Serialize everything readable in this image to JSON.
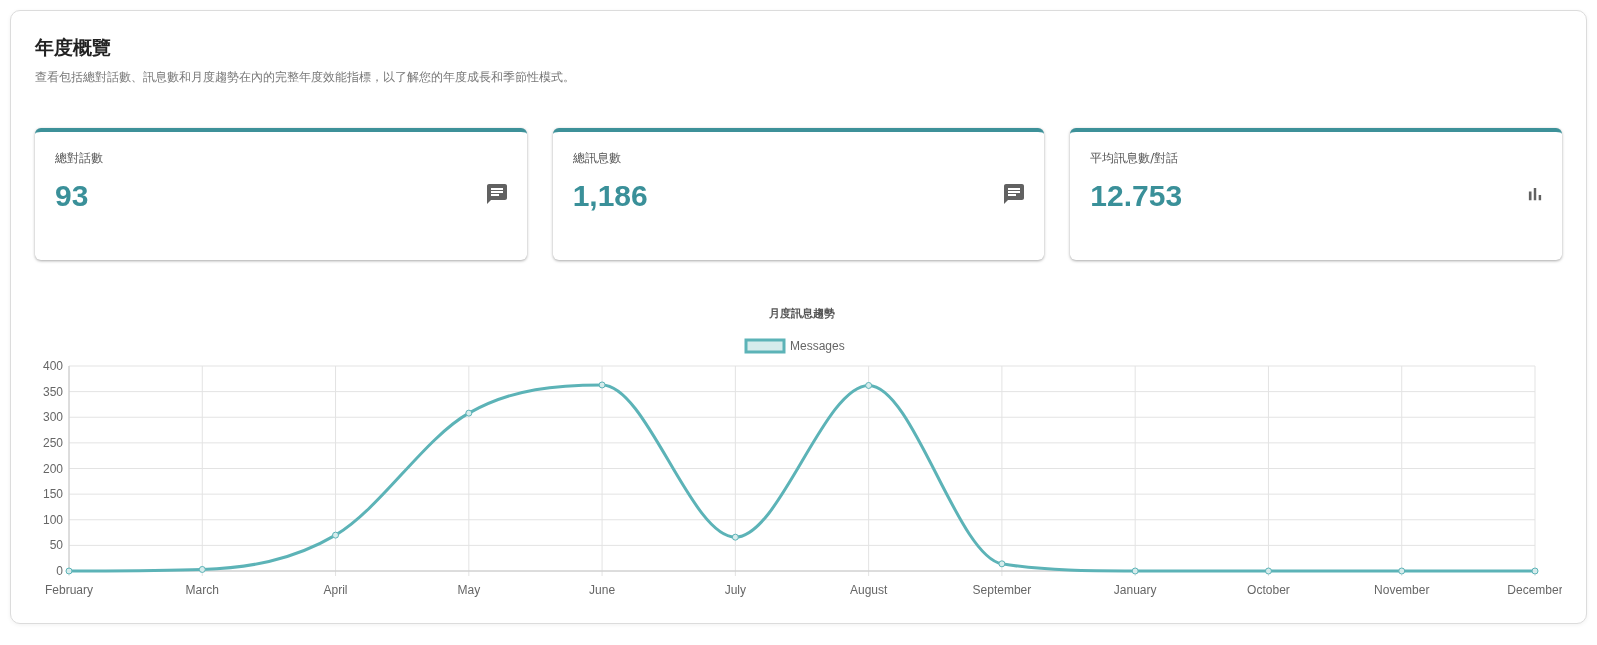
{
  "header": {
    "title": "年度概覽",
    "subtitle": "查看包括總對話數、訊息數和月度趨勢在內的完整年度效能指標，以了解您的年度成長和季節性模式。"
  },
  "stats": [
    {
      "label": "總對話數",
      "value": "93",
      "kind": "total"
    },
    {
      "label": "總訊息數",
      "value": "1,186",
      "kind": "total"
    },
    {
      "label": "平均訊息數/對話",
      "value": "12.753",
      "kind": "average"
    }
  ],
  "chart": {
    "chart_data": {
      "type": "line",
      "title": "月度訊息趨勢",
      "categories": [
        "February",
        "March",
        "April",
        "May",
        "June",
        "July",
        "August",
        "September",
        "January",
        "October",
        "November",
        "December"
      ],
      "grid": true,
      "series": [
        {
          "name": "Messages",
          "color": "#5cb3b7",
          "marker": "circle",
          "values": [
            0,
            3,
            70,
            308,
            363,
            66,
            362,
            14,
            0,
            0,
            0,
            0
          ]
        }
      ],
      "ylim": [
        0,
        400
      ],
      "yticks": [
        0,
        50,
        100,
        150,
        200,
        250,
        300,
        350,
        400
      ]
    }
  }
}
